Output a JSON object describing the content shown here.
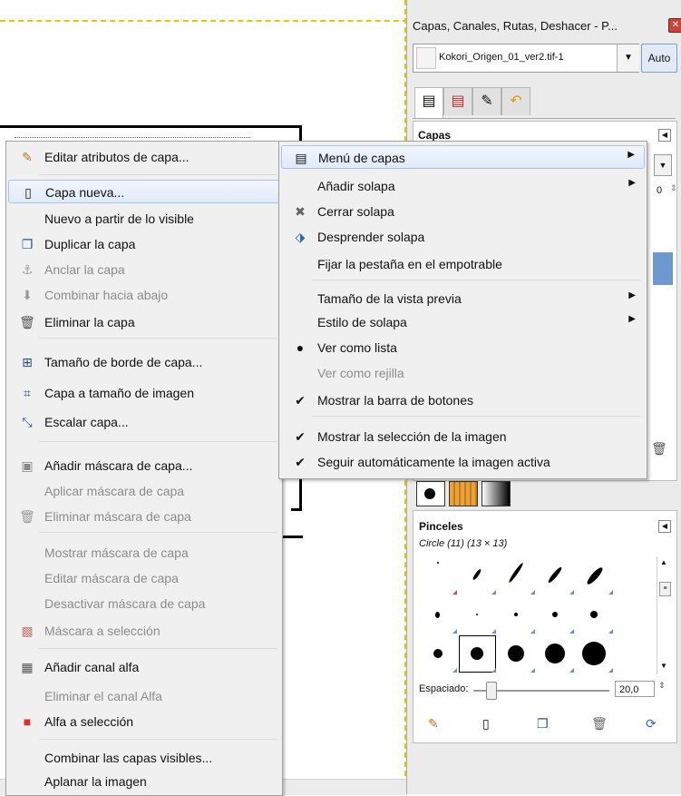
{
  "dock": {
    "title": "Capas, Canales, Rutas, Deshacer - P...",
    "close_glyph": "✕",
    "image_name": "Kokori_Origen_01_ver2.tif-1",
    "auto_label": "Auto",
    "layers_title": "Capas",
    "layers_num": "0",
    "brushes_title": "Pinceles",
    "brush_name": "Circle (11) (13 × 13)",
    "spacing_label": "Espaciado:",
    "spacing_value": "20,0"
  },
  "layer_menu": {
    "items": [
      "Editar atributos de capa...",
      "Capa nueva...",
      "Nuevo a partir de lo visible",
      "Duplicar la capa",
      "Anclar la capa",
      "Combinar hacia abajo",
      "Eliminar la capa",
      "Tamaño de borde de capa...",
      "Capa a tamaño de imagen",
      "Escalar capa...",
      "Añadir máscara de capa...",
      "Aplicar máscara de capa",
      "Eliminar máscara de capa",
      "Mostrar máscara de capa",
      "Editar máscara de capa",
      "Desactivar máscara de capa",
      "Máscara a selección",
      "Añadir canal alfa",
      "Eliminar el canal Alfa",
      "Alfa a selección",
      "Combinar las capas visibles...",
      "Aplanar la imagen"
    ]
  },
  "tab_menu": {
    "items": [
      "Menú de capas",
      "Añadir solapa",
      "Cerrar solapa",
      "Desprender solapa",
      "Fijar la pestaña en el empotrable",
      "Tamaño de la vista previa",
      "Estilo de solapa",
      "Ver como lista",
      "Ver como rejilla",
      "Mostrar la barra de botones",
      "Mostrar la selección de la imagen",
      "Seguir automáticamente la imagen activa"
    ]
  },
  "colors": {
    "accent": "#6d99ce",
    "menu_bg": "#f0f0f0",
    "guide": "#e8c800"
  }
}
